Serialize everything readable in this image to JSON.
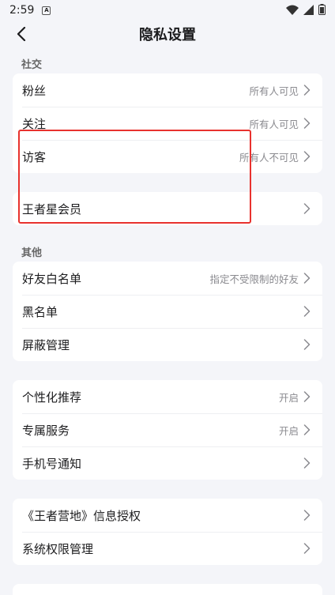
{
  "status_bar": {
    "time": "2:59"
  },
  "header": {
    "title": "隐私设置"
  },
  "sections": [
    {
      "label": "社交"
    },
    {
      "label": "其他"
    }
  ],
  "social": [
    {
      "label": "粉丝",
      "value": "所有人可见"
    },
    {
      "label": "关注",
      "value": "所有人可见"
    },
    {
      "label": "访客",
      "value": "所有人不可见"
    }
  ],
  "vip": [
    {
      "label": "王者星会员",
      "value": ""
    }
  ],
  "other": [
    {
      "label": "好友白名单",
      "value": "指定不受限制的好友"
    },
    {
      "label": "黑名单",
      "value": ""
    },
    {
      "label": "屏蔽管理",
      "value": ""
    }
  ],
  "personal": [
    {
      "label": "个性化推荐",
      "value": "开启"
    },
    {
      "label": "专属服务",
      "value": "开启"
    },
    {
      "label": "手机号通知",
      "value": ""
    }
  ],
  "auth": [
    {
      "label": "《王者营地》信息授权",
      "value": ""
    },
    {
      "label": "系统权限管理",
      "value": ""
    }
  ],
  "colors": {
    "background": "#f4f5f9",
    "card": "#ffffff",
    "highlight": "#e8322e"
  }
}
